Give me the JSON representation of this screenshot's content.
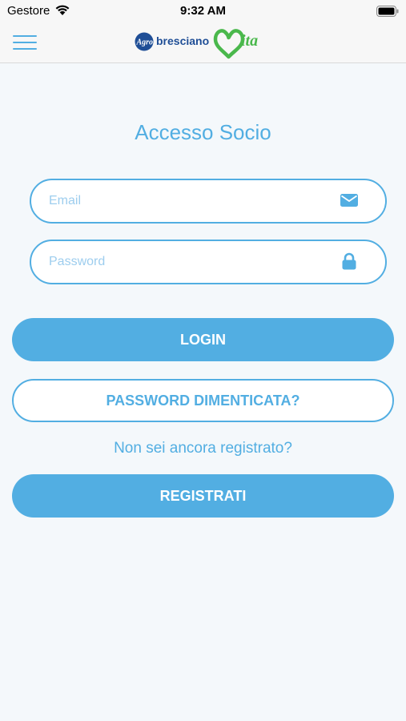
{
  "status_bar": {
    "carrier": "Gestore",
    "time": "9:32 AM"
  },
  "nav": {
    "logo": {
      "brand_prefix": "Agro",
      "brand_word": "bresciano",
      "brand_suffix": "ita"
    }
  },
  "login": {
    "title": "Accesso Socio",
    "email": {
      "placeholder": "Email",
      "value": ""
    },
    "password": {
      "placeholder": "Password",
      "value": ""
    },
    "login_label": "LOGIN",
    "forgot_label": "PASSWORD DIMENTICATA?",
    "register_prompt": "Non sei ancora registrato?",
    "register_label": "REGISTRATI"
  },
  "colors": {
    "accent": "#52aee2",
    "logo_blue": "#1f4e96",
    "logo_green": "#4ab84c",
    "background": "#f4f8fb"
  },
  "icons": {
    "menu": "hamburger-icon",
    "email": "envelope-icon",
    "password": "lock-icon",
    "wifi": "wifi-icon",
    "battery": "battery-icon"
  }
}
